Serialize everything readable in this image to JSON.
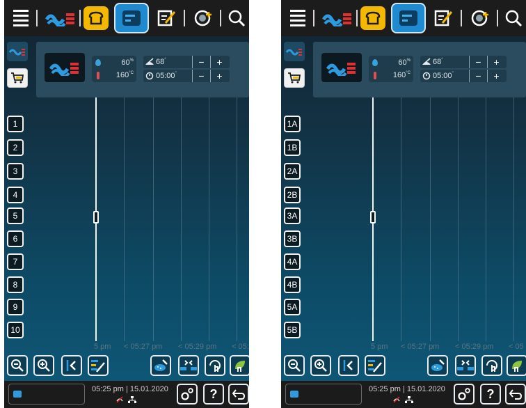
{
  "screens": [
    {
      "id": "screen-a",
      "settings": {
        "humidity": {
          "value": "60",
          "unit": "%"
        },
        "temperature": {
          "value": "160",
          "unit": "°C"
        },
        "core_temp": {
          "value": "68",
          "unit": "°"
        },
        "time": {
          "value": "05:00",
          "unit": "''"
        },
        "minus_label": "−",
        "plus_label": "+"
      },
      "racks": [
        "1",
        "2",
        "3",
        "4",
        "5",
        "6",
        "7",
        "8",
        "9",
        "10"
      ],
      "time_labels": [
        "5 pm",
        "< 05:27 pm",
        "< 05:29 pm",
        "< 05:"
      ]
    },
    {
      "id": "screen-b",
      "settings": {
        "humidity": {
          "value": "60",
          "unit": "%"
        },
        "temperature": {
          "value": "160",
          "unit": "°C"
        },
        "core_temp": {
          "value": "68",
          "unit": "°"
        },
        "time": {
          "value": "05:00",
          "unit": "''"
        },
        "minus_label": "−",
        "plus_label": "+"
      },
      "racks": [
        "1A",
        "1B",
        "2A",
        "2B",
        "3A",
        "3B",
        "4A",
        "4B",
        "5A",
        "5B"
      ],
      "time_labels": [
        "5 pm",
        "< 05:27 pm",
        "< 05:29 pm",
        "< 05"
      ]
    }
  ],
  "status": {
    "time": "05:25 pm",
    "separator": "|",
    "date": "15.01.2020",
    "help_label": "?"
  },
  "colors": {
    "accent_blue": "#1f8ad0",
    "bake_yellow": "#f5b800",
    "combi_red": "#e03030"
  },
  "icons": {
    "top_bar": [
      "menu-icon",
      "combi-steam-icon",
      "bake-icon",
      "ipm-icon",
      "edit-icon",
      "add-program-icon",
      "search-icon"
    ],
    "bottom_toolbar": [
      "zoom-out-icon",
      "zoom-in-icon",
      "jump-to-now-icon",
      "edit-list-icon",
      "cleaning-icon",
      "compress-icon",
      "touch-timer-icon",
      "eco-icon"
    ],
    "status_bar": [
      "settings-icon",
      "help-icon",
      "back-icon"
    ]
  }
}
